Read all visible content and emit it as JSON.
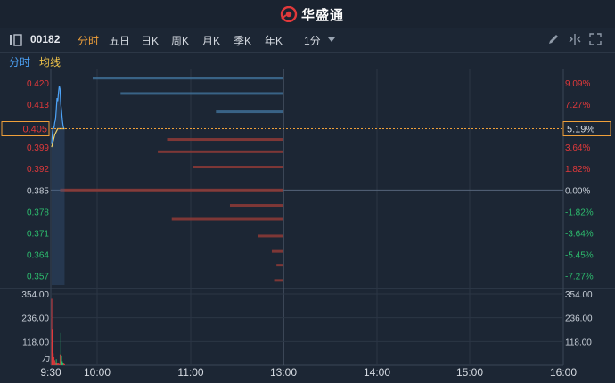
{
  "brand": {
    "name": "华盛通"
  },
  "toolbar": {
    "stock_code": "00182",
    "tabs": [
      {
        "label": "分时",
        "active": true
      },
      {
        "label": "五日",
        "active": false
      },
      {
        "label": "日K",
        "active": false
      },
      {
        "label": "周K",
        "active": false
      },
      {
        "label": "月K",
        "active": false
      },
      {
        "label": "季K",
        "active": false
      },
      {
        "label": "年K",
        "active": false
      }
    ],
    "interval": "1分",
    "tools": [
      "edit-icon",
      "crosshair-icon",
      "fullscreen-icon"
    ]
  },
  "subtabs": {
    "intraday": "分时",
    "avg_line": "均线"
  },
  "colors": {
    "up": "#e0393b",
    "down": "#2dbd6e",
    "price_line": "#4da3f7",
    "avg_line": "#f0d36a",
    "accent": "#f0a03a",
    "background": "#1c2634"
  },
  "chart_data": {
    "type": "line",
    "prev_close": 0.385,
    "price_ticks": [
      "0.420",
      "0.413",
      "0.405",
      "0.399",
      "0.392",
      "0.385",
      "0.378",
      "0.371",
      "0.364",
      "0.357"
    ],
    "pct_ticks": [
      "9.09%",
      "7.27%",
      "5.19%",
      "3.64%",
      "1.82%",
      "0.00%",
      "-1.82%",
      "-3.64%",
      "-5.45%",
      "-7.27%"
    ],
    "current_price": "0.405",
    "current_pct": "5.19%",
    "time_ticks": [
      "9:30",
      "10:00",
      "11:00",
      "13:00",
      "14:00",
      "15:00",
      "16:00"
    ],
    "volume_ticks": [
      "354.00",
      "236.00",
      "118.00"
    ],
    "volume_unit": "万",
    "ylim": [
      0.354,
      0.422
    ],
    "price_series": [
      {
        "t": 0,
        "v": 0.4
      },
      {
        "t": 1,
        "v": 0.404
      },
      {
        "t": 2,
        "v": 0.406
      },
      {
        "t": 3,
        "v": 0.405
      },
      {
        "t": 4,
        "v": 0.407
      },
      {
        "t": 5,
        "v": 0.408
      },
      {
        "t": 6,
        "v": 0.411
      },
      {
        "t": 7,
        "v": 0.415
      },
      {
        "t": 8,
        "v": 0.414
      },
      {
        "t": 9,
        "v": 0.417
      },
      {
        "t": 10,
        "v": 0.419
      },
      {
        "t": 11,
        "v": 0.418
      },
      {
        "t": 12,
        "v": 0.413
      },
      {
        "t": 13,
        "v": 0.411
      },
      {
        "t": 14,
        "v": 0.408
      },
      {
        "t": 15,
        "v": 0.406
      },
      {
        "t": 16,
        "v": 0.405
      },
      {
        "t": 17,
        "v": 0.405
      }
    ],
    "avg_series": [
      {
        "t": 0,
        "v": 0.399
      },
      {
        "t": 2,
        "v": 0.401
      },
      {
        "t": 4,
        "v": 0.403
      },
      {
        "t": 6,
        "v": 0.404
      },
      {
        "t": 8,
        "v": 0.405
      },
      {
        "t": 10,
        "v": 0.405
      },
      {
        "t": 12,
        "v": 0.405
      },
      {
        "t": 14,
        "v": 0.405
      },
      {
        "t": 17,
        "v": 0.405
      }
    ],
    "volume_series": [
      {
        "t": 0,
        "v": 330,
        "dir": "up"
      },
      {
        "t": 1,
        "v": 180,
        "dir": "up"
      },
      {
        "t": 2,
        "v": 60,
        "dir": "up"
      },
      {
        "t": 3,
        "v": 40,
        "dir": "up"
      },
      {
        "t": 4,
        "v": 25,
        "dir": "up"
      },
      {
        "t": 5,
        "v": 15,
        "dir": "up"
      },
      {
        "t": 6,
        "v": 30,
        "dir": "down"
      },
      {
        "t": 7,
        "v": 10,
        "dir": "up"
      },
      {
        "t": 8,
        "v": 8,
        "dir": "up"
      },
      {
        "t": 9,
        "v": 12,
        "dir": "up"
      },
      {
        "t": 10,
        "v": 6,
        "dir": "up"
      },
      {
        "t": 11,
        "v": 50,
        "dir": "up"
      },
      {
        "t": 12,
        "v": 160,
        "dir": "down"
      },
      {
        "t": 13,
        "v": 45,
        "dir": "down"
      },
      {
        "t": 14,
        "v": 20,
        "dir": "down"
      },
      {
        "t": 15,
        "v": 10,
        "dir": "down"
      },
      {
        "t": 16,
        "v": 8,
        "dir": "up"
      },
      {
        "t": 17,
        "v": 5,
        "dir": "up"
      }
    ],
    "volume_ylim": [
      0,
      354
    ],
    "price_levels": [
      {
        "price": 0.4215,
        "width": 0.82,
        "side": "sell"
      },
      {
        "price": 0.4165,
        "width": 0.7,
        "side": "sell"
      },
      {
        "price": 0.4105,
        "width": 0.29,
        "side": "sell"
      },
      {
        "price": 0.4015,
        "width": 0.5,
        "side": "buy"
      },
      {
        "price": 0.3975,
        "width": 0.54,
        "side": "buy"
      },
      {
        "price": 0.3925,
        "width": 0.39,
        "side": "buy"
      },
      {
        "price": 0.385,
        "width": 0.96,
        "side": "buy"
      },
      {
        "price": 0.38,
        "width": 0.23,
        "side": "buy"
      },
      {
        "price": 0.3755,
        "width": 0.48,
        "side": "buy"
      },
      {
        "price": 0.37,
        "width": 0.11,
        "side": "buy"
      },
      {
        "price": 0.365,
        "width": 0.05,
        "side": "buy"
      },
      {
        "price": 0.3605,
        "width": 0.03,
        "side": "buy"
      },
      {
        "price": 0.3555,
        "width": 0.04,
        "side": "buy"
      }
    ]
  }
}
